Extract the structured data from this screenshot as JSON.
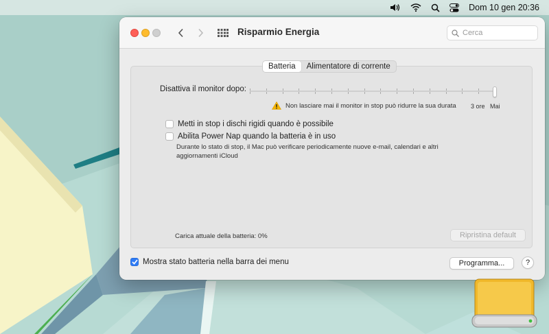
{
  "menubar": {
    "icons": [
      "volume-icon",
      "wifi-icon",
      "search-icon",
      "control-center-icon"
    ],
    "datetime": "Dom 10 gen  20:36"
  },
  "window": {
    "title": "Risparmio Energia",
    "search_placeholder": "Cerca",
    "tabs": [
      {
        "label": "Batteria",
        "active": true
      },
      {
        "label": "Alimentatore di corrente",
        "active": false
      }
    ],
    "monitor_off": {
      "label": "Disattiva il monitor dopo:",
      "warning": "Non lasciare mai il monitor in stop può ridurre la sua durata",
      "tick_labels": [
        "3 ore",
        "Mai"
      ],
      "selected": "Mai"
    },
    "options": [
      {
        "label": "Metti in stop i dischi rigidi quando è possibile",
        "checked": false
      },
      {
        "label": "Abilita Power Nap quando la batteria è in uso",
        "checked": false,
        "description": "Durante lo stato di stop, il Mac può verificare periodicamente nuove e-mail, calendari e altri aggiornamenti iCloud"
      }
    ],
    "battery_level": "Carica attuale della batteria: 0%",
    "restore_button": "Ripristina default",
    "show_in_menubar": {
      "label": "Mostra stato batteria nella barra dei menu",
      "checked": true
    },
    "schedule_button": "Programma...",
    "help_label": "?"
  },
  "colors": {
    "accent": "#2f7bf6",
    "close": "#fe5f57",
    "minimize": "#febc2e",
    "zoom_disabled": "#cfcfcf",
    "warning": "#f4b400"
  }
}
